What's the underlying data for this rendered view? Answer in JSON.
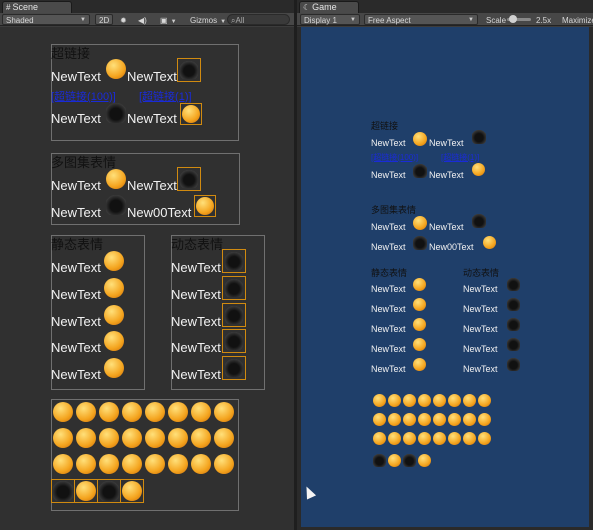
{
  "scene": {
    "tab": "Scene",
    "toolbar": {
      "shading": "Shaded",
      "mode2d": "2D",
      "gizmos": "Gizmos",
      "search": "All"
    },
    "sections": {
      "hyperlink": "超链接",
      "multi_atlas": "多图集表情",
      "static": "静态表情",
      "dynamic": "动态表情"
    },
    "text": "NewText",
    "text2": "New00Text",
    "link1": "[超链接(100)]",
    "link2": "[超链接(1)]"
  },
  "game": {
    "tab": "Game",
    "toolbar": {
      "display": "Display 1",
      "aspect": "Free Aspect",
      "scale_label": "Scale",
      "scale_value": "2.5x",
      "maximize": "Maximize"
    },
    "sections": {
      "hyperlink": "超链接",
      "multi_atlas": "多图集表情",
      "static": "静态表情",
      "dynamic": "动态表情"
    },
    "text": "NewText",
    "text2": "New00Text",
    "link1": "[超链接(100)]",
    "link2": "[超链接(1)]"
  },
  "colors": {
    "game_bg": "#1f3f6a",
    "link": "#1a2bd8",
    "emoji": "#f4a41e"
  }
}
